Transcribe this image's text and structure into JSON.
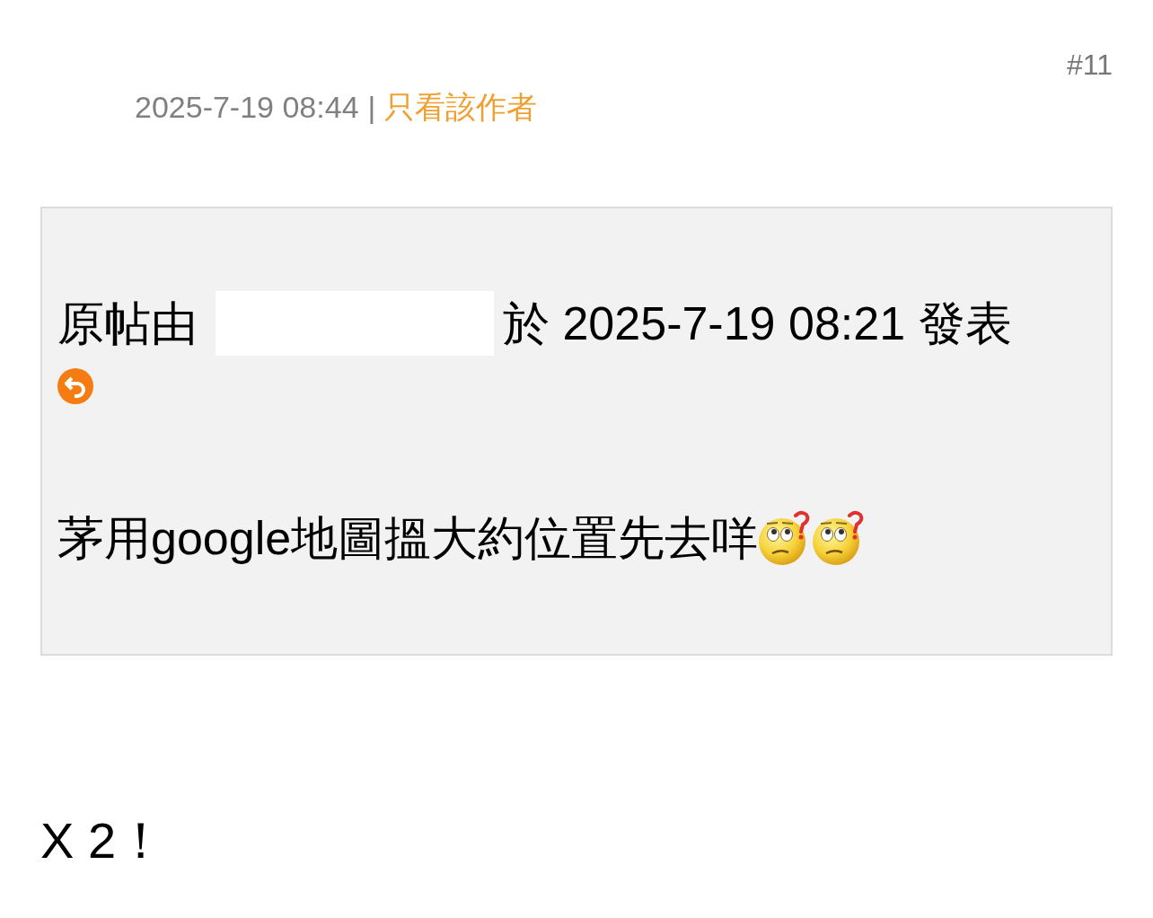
{
  "post": {
    "number": "#11",
    "timestamp": "2025-7-19 08:44",
    "separator": "|",
    "author_filter_link": "只看該作者"
  },
  "quote": {
    "prefix": "原帖由",
    "author_redacted": true,
    "suffix": "於 2025-7-19 08:21 發表",
    "text": "茅用google地圖搵大約位置先去咩",
    "emojis": [
      {
        "kind": "confused"
      },
      {
        "kind": "confused"
      }
    ]
  },
  "reply": "X 2！"
}
